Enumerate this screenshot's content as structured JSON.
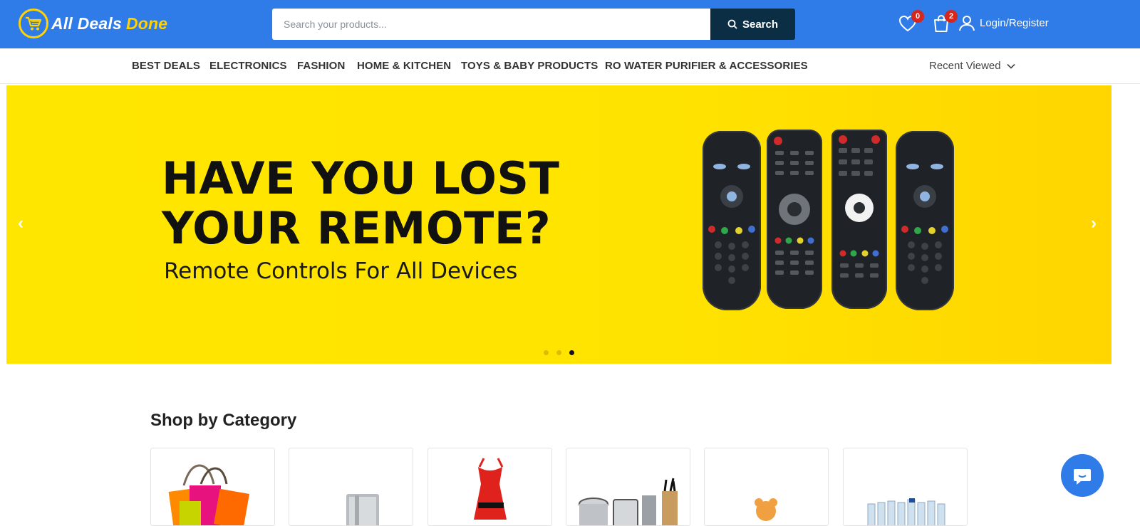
{
  "header": {
    "brand_primary": "All Deals",
    "brand_accent": "Done",
    "search_placeholder": "Search your products...",
    "search_button": "Search",
    "wishlist_count": "0",
    "cart_count": "2",
    "login_label": "Login/Register",
    "brand_color": "#2f7be8",
    "accent_color": "#ffd200"
  },
  "nav": {
    "categories": [
      "BEST DEALS",
      "ELECTRONICS",
      "FASHION",
      "HOME & KITCHEN",
      "TOYS & BABY PRODUCTS",
      "RO WATER PURIFIER & ACCESSORIES"
    ],
    "recent_viewed": "Recent Viewed"
  },
  "hero": {
    "title_line1": "HAVE YOU LOST",
    "title_line2": "YOUR REMOTE?",
    "subtitle": "Remote Controls For All Devices",
    "slide_count": 3,
    "active_slide": 3,
    "prev_arrow": "‹",
    "next_arrow": "›"
  },
  "shop_by_category": {
    "title": "Shop by Category"
  }
}
